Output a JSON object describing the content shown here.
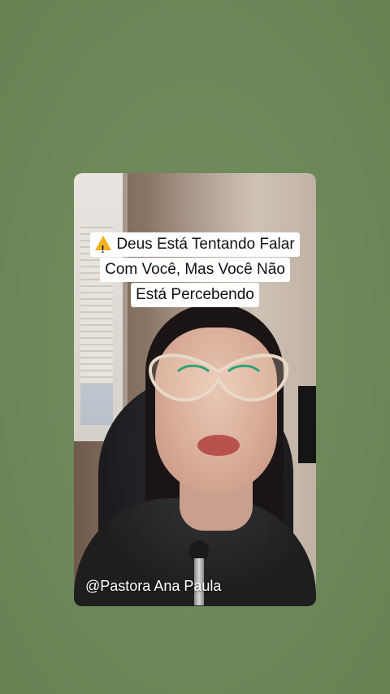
{
  "video": {
    "caption": {
      "icon": "warning-icon",
      "lines": [
        "Deus Está Tentando Falar",
        "Com Você, Mas Você Não",
        "Está Percebendo"
      ]
    },
    "watermark": "@Pastora Ana Paula"
  },
  "colors": {
    "background": "#6f8a5a",
    "caption_bg": "#ffffff",
    "warning": "#f2b01e"
  }
}
